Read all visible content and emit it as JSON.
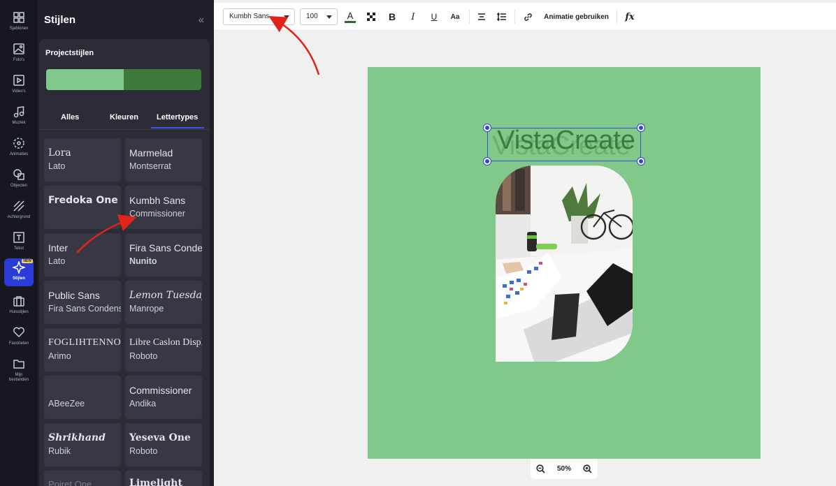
{
  "rail": {
    "items": [
      {
        "label": "Sjablonen",
        "icon": "templates-icon"
      },
      {
        "label": "Foto's",
        "icon": "photo-icon"
      },
      {
        "label": "Video's",
        "icon": "video-icon"
      },
      {
        "label": "Muziek",
        "icon": "music-icon"
      },
      {
        "label": "Animaties",
        "icon": "animation-icon"
      },
      {
        "label": "Objecten",
        "icon": "objects-icon"
      },
      {
        "label": "Achtergrond",
        "icon": "background-icon"
      },
      {
        "label": "Tekst",
        "icon": "text-icon"
      },
      {
        "label": "Stijlen",
        "icon": "styles-icon",
        "badge": "NEW"
      },
      {
        "label": "Huisstijlen",
        "icon": "brand-kit-icon"
      },
      {
        "label": "Favorieten",
        "icon": "heart-icon"
      },
      {
        "label": "Mijn bestanden",
        "icon": "folder-icon"
      }
    ]
  },
  "panel": {
    "title": "Stijlen",
    "collapse_glyph": "«",
    "project_styles_label": "Projectstijlen",
    "swatch_colors": [
      "#80c98a",
      "#3f7a3d"
    ],
    "tabs": [
      "Alles",
      "Kleuren",
      "Lettertypes"
    ],
    "active_tab": "Lettertypes",
    "font_pairs": [
      {
        "primary": "Lora",
        "secondary": "Lato"
      },
      {
        "primary": "Marmelad",
        "secondary": "Montserrat"
      },
      {
        "primary": "Fredoka One",
        "secondary": ""
      },
      {
        "primary": "Kumbh Sans",
        "secondary": "Commissioner"
      },
      {
        "primary": "Inter",
        "secondary": "Lato"
      },
      {
        "primary": "Fira Sans Condensed",
        "secondary": "Nunito"
      },
      {
        "primary": "Public Sans",
        "secondary": "Fira Sans Condensed"
      },
      {
        "primary": "Lemon Tuesday",
        "secondary": "Manrope"
      },
      {
        "primary": "FOGLIHTENNO",
        "secondary": "Arimo"
      },
      {
        "primary": "Libre Caslon Display",
        "secondary": "Roboto"
      },
      {
        "primary": "",
        "secondary": "ABeeZee"
      },
      {
        "primary": "Commissioner",
        "secondary": "Andika"
      },
      {
        "primary": "Shrikhand",
        "secondary": "Rubik"
      },
      {
        "primary": "Yeseva One",
        "secondary": "Roboto"
      },
      {
        "primary": "Poiret One",
        "secondary": ""
      },
      {
        "primary": "Limelight",
        "secondary": ""
      }
    ]
  },
  "toolbar": {
    "font_family": "Kumbh Sans",
    "font_size": "100",
    "bold_glyph": "B",
    "italic_glyph": "I",
    "underline_glyph": "U",
    "case_glyph": "Aa",
    "animate_label": "Animatie gebruiken",
    "fx_label": "fx",
    "text_color": "#2f6a31"
  },
  "canvas": {
    "background": "#80c98a",
    "headline": "VistaCreate"
  },
  "zoom": {
    "level": "50%"
  }
}
